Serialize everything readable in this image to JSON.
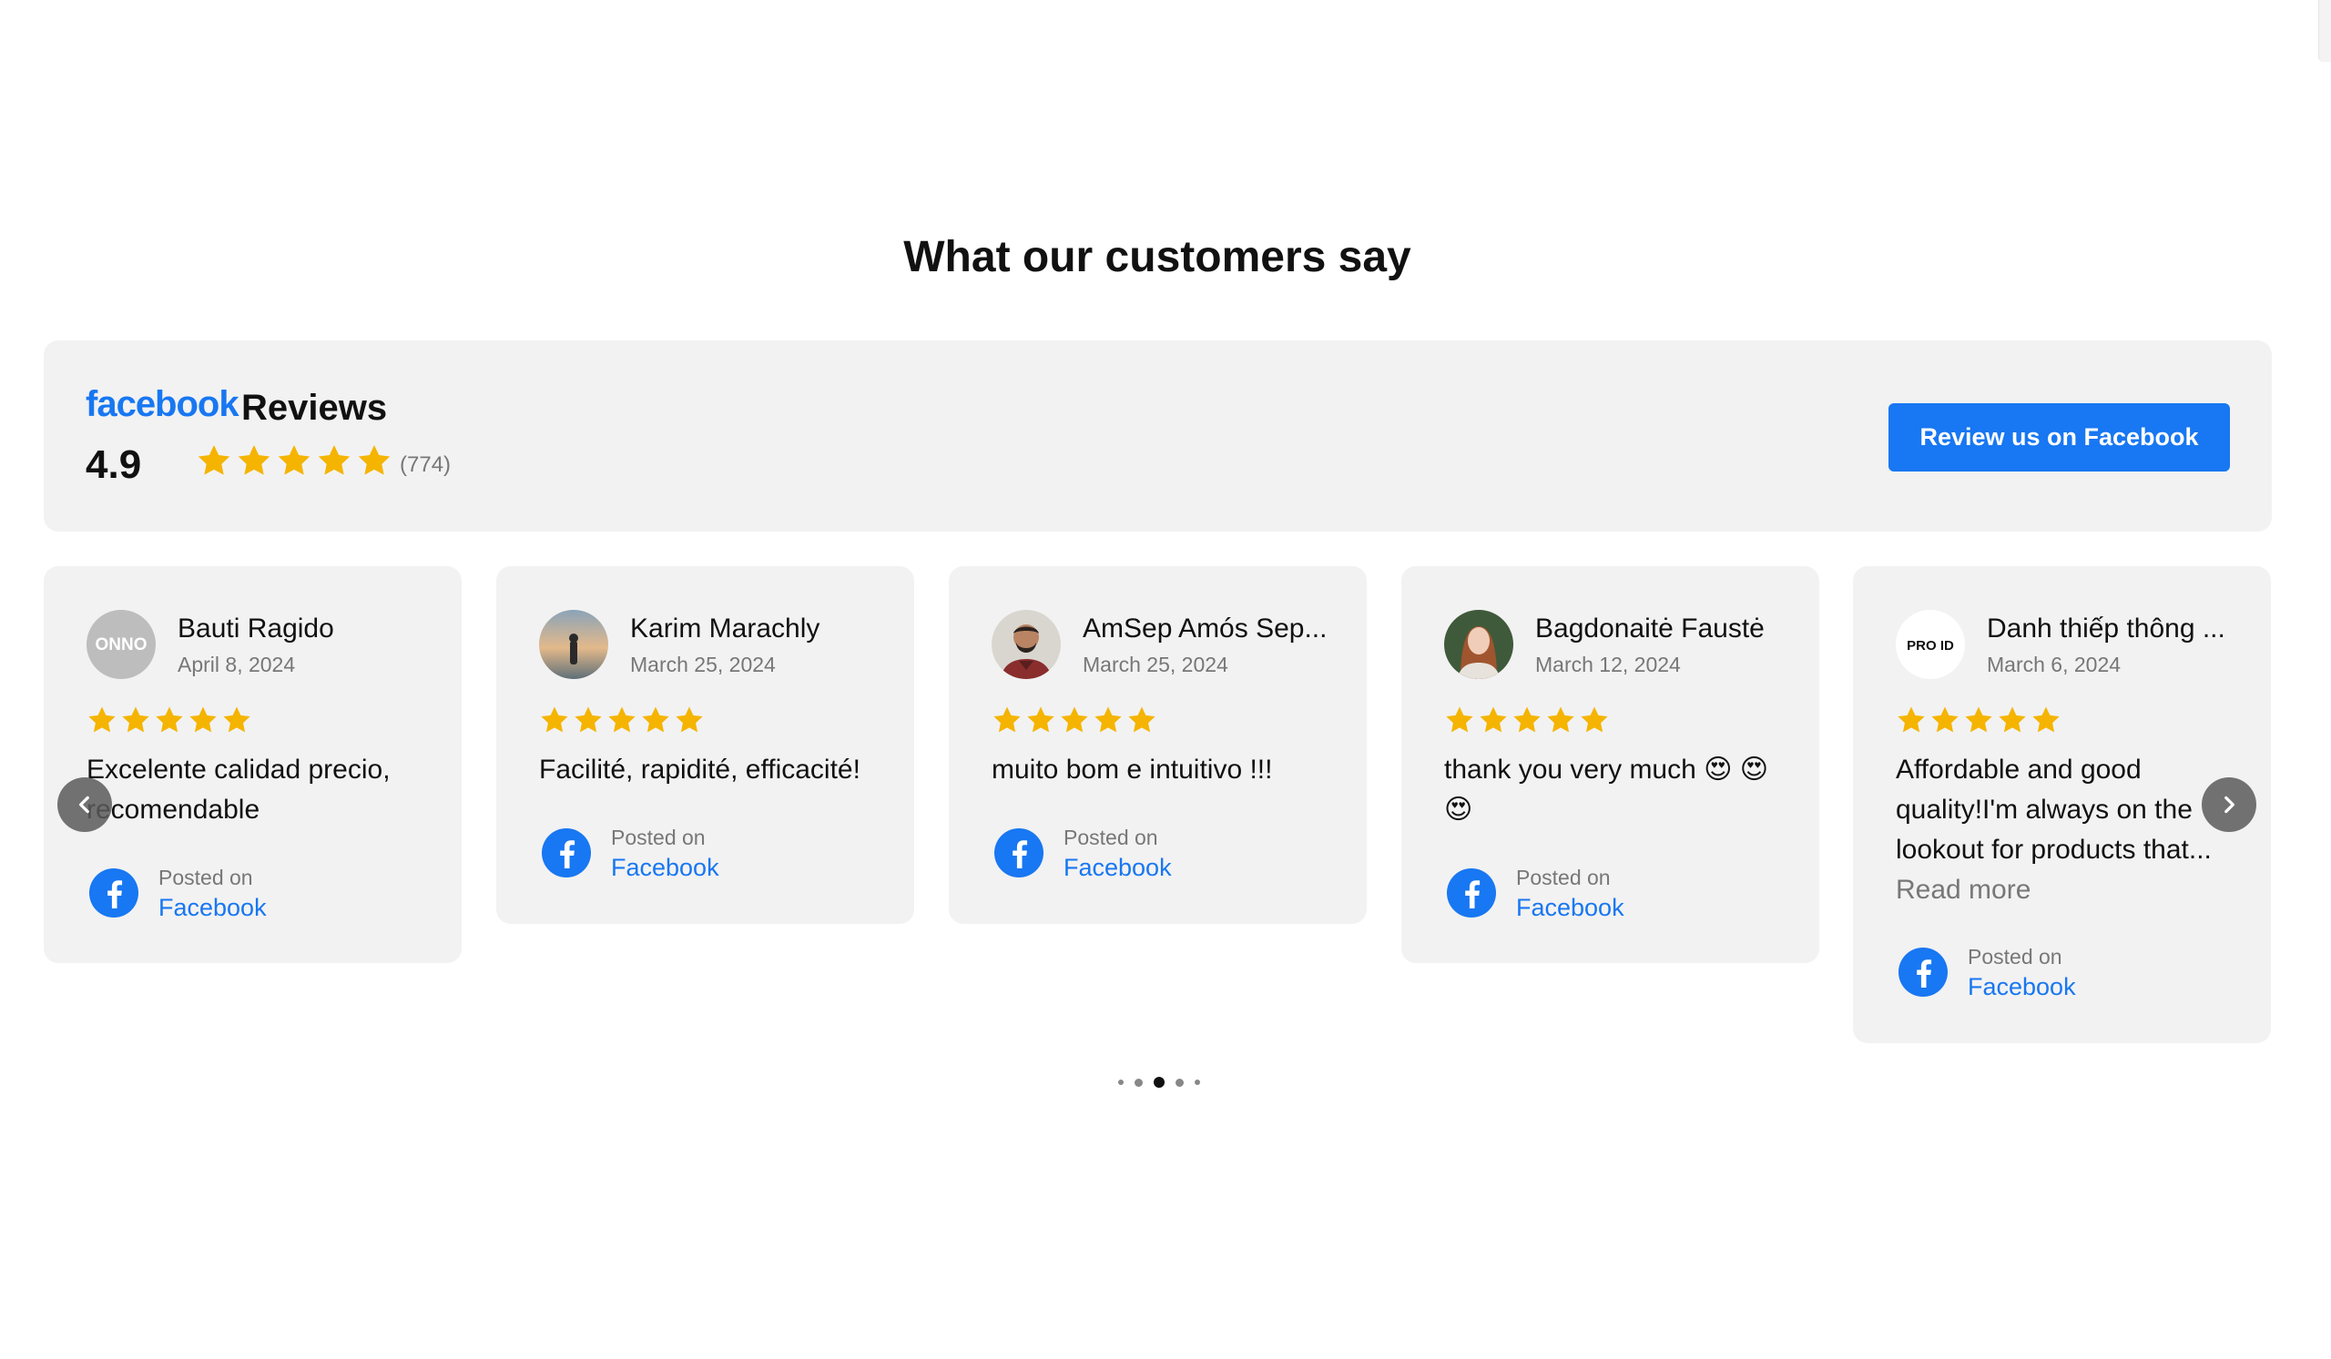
{
  "section": {
    "title": "What our customers say"
  },
  "summary": {
    "brand": "facebook",
    "reviews_word": "Reviews",
    "rating": "4.9",
    "stars": 5,
    "count": "(774)",
    "button_label": "Review us on Facebook"
  },
  "colors": {
    "facebook_blue": "#1877f2",
    "star": "#f5b400",
    "card_bg": "#f2f2f2"
  },
  "cards": [
    {
      "name": "Bauti Ragido",
      "date": "April 8, 2024",
      "stars": 5,
      "text": "Excelente calidad precio, recomendable",
      "read_more": "",
      "posted_on": "Posted on",
      "source": "Facebook"
    },
    {
      "name": "Karim Marachly",
      "date": "March 25, 2024",
      "stars": 5,
      "text": "Facilité, rapidité, efficacité!",
      "read_more": "",
      "posted_on": "Posted on",
      "source": "Facebook"
    },
    {
      "name": "AmSep Amós Sep...",
      "date": "March 25, 2024",
      "stars": 5,
      "text": "muito bom e intuitivo !!!",
      "read_more": "",
      "posted_on": "Posted on",
      "source": "Facebook"
    },
    {
      "name": "Bagdonaitė Faustė",
      "date": "March 12, 2024",
      "stars": 5,
      "text": "thank you very much 😍 😍😍",
      "read_more": "",
      "posted_on": "Posted on",
      "source": "Facebook"
    },
    {
      "name": "Danh thiếp thông ...",
      "date": "March 6, 2024",
      "stars": 5,
      "text": "Affordable and good quality!I'm always on the lookout for products that...",
      "read_more": "Read more",
      "posted_on": "Posted on",
      "source": "Facebook"
    }
  ],
  "avatar_text": {
    "card0": "ONNO",
    "card4": "PRO ID"
  },
  "icons": {
    "prev": "chevron-left-icon",
    "next": "chevron-right-icon",
    "star": "star-icon",
    "facebook": "facebook-icon"
  },
  "pagination": {
    "total": 5,
    "active": 3
  }
}
